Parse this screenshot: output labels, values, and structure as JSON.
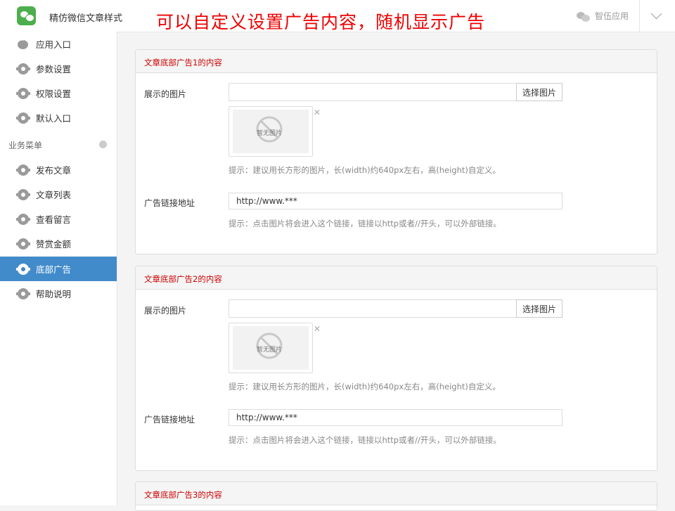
{
  "header": {
    "app_title": "精仿微信文章样式",
    "banner": "可以自定义设置广告内容，随机显示广告",
    "account_label": "智伍应用"
  },
  "sidebar": {
    "top_items": [
      {
        "label": "应用入口",
        "icon": "chat-bubble-icon"
      },
      {
        "label": "参数设置",
        "icon": "gear-icon"
      },
      {
        "label": "权限设置",
        "icon": "gear-icon"
      },
      {
        "label": "默认入口",
        "icon": "gear-icon"
      }
    ],
    "section_label": "业务菜单",
    "business_items": [
      {
        "label": "发布文章",
        "icon": "gear-icon"
      },
      {
        "label": "文章列表",
        "icon": "gear-icon"
      },
      {
        "label": "查看留言",
        "icon": "gear-icon"
      },
      {
        "label": "赞赏金额",
        "icon": "gear-icon"
      },
      {
        "label": "底部广告",
        "icon": "gear-icon",
        "active": true
      },
      {
        "label": "帮助说明",
        "icon": "gear-icon"
      }
    ],
    "active_color": "#428bca"
  },
  "panels": [
    {
      "title": "文章底部广告1的内容",
      "image_label": "展示的图片",
      "pick_button": "选择图片",
      "no_image_text": "暂无图片",
      "image_hint": "提示：建议用长方形的图片，长(width)约640px左右，高(height)自定义。",
      "link_label": "广告链接地址",
      "link_value": "http://www.***",
      "link_hint": "提示：点击图片将会进入这个链接，链接以http或者//开头，可以外部链接。"
    },
    {
      "title": "文章底部广告2的内容",
      "image_label": "展示的图片",
      "pick_button": "选择图片",
      "no_image_text": "暂无图片",
      "image_hint": "提示：建议用长方形的图片，长(width)约640px左右，高(height)自定义。",
      "link_label": "广告链接地址",
      "link_value": "http://www.***",
      "link_hint": "提示：点击图片将会进入这个链接，链接以http或者//开头，可以外部链接。"
    },
    {
      "title": "文章底部广告3的内容"
    }
  ]
}
